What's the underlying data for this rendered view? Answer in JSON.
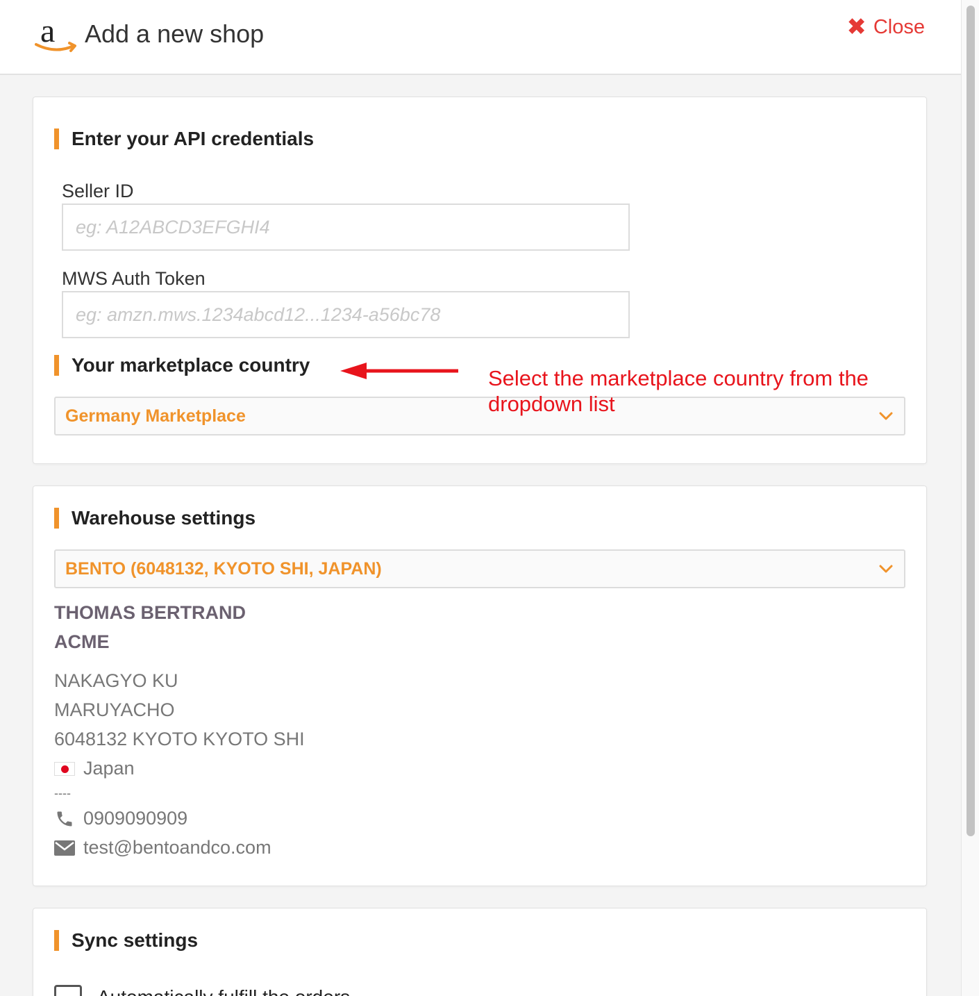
{
  "header": {
    "logo_letter": "a",
    "title": "Add a new shop",
    "close_label": "Close",
    "close_icon": "close-x-icon",
    "accent_color": "#e53935"
  },
  "api_section": {
    "title": "Enter your API credentials",
    "seller_id": {
      "label": "Seller ID",
      "value": "",
      "placeholder": "eg: A12ABCD3EFGHI4"
    },
    "mws_token": {
      "label": "MWS Auth Token",
      "value": "",
      "placeholder": "eg: amzn.mws.1234abcd12...1234-a56bc78"
    },
    "marketplace_title": "Your marketplace country",
    "marketplace_selected": "Germany Marketplace"
  },
  "annotation": {
    "text": "Select the marketplace country from the dropdown list",
    "color": "#e8141c"
  },
  "warehouse_section": {
    "title": "Warehouse settings",
    "selected": "BENTO (6048132, KYOTO SHI, JAPAN)",
    "name": "THOMAS BERTRAND",
    "company": "ACME",
    "address_line1": "NAKAGYO KU",
    "address_line2": "MARUYACHO",
    "address_line3": "6048132 KYOTO KYOTO SHI",
    "country": "Japan",
    "separator": "----",
    "phone": "0909090909",
    "email": "test@bentoandco.com"
  },
  "sync_section": {
    "title": "Sync settings",
    "option_label": "Automatically fulfill the orders"
  },
  "colors": {
    "accent": "#f0932b",
    "address_name": "#6b6170"
  }
}
